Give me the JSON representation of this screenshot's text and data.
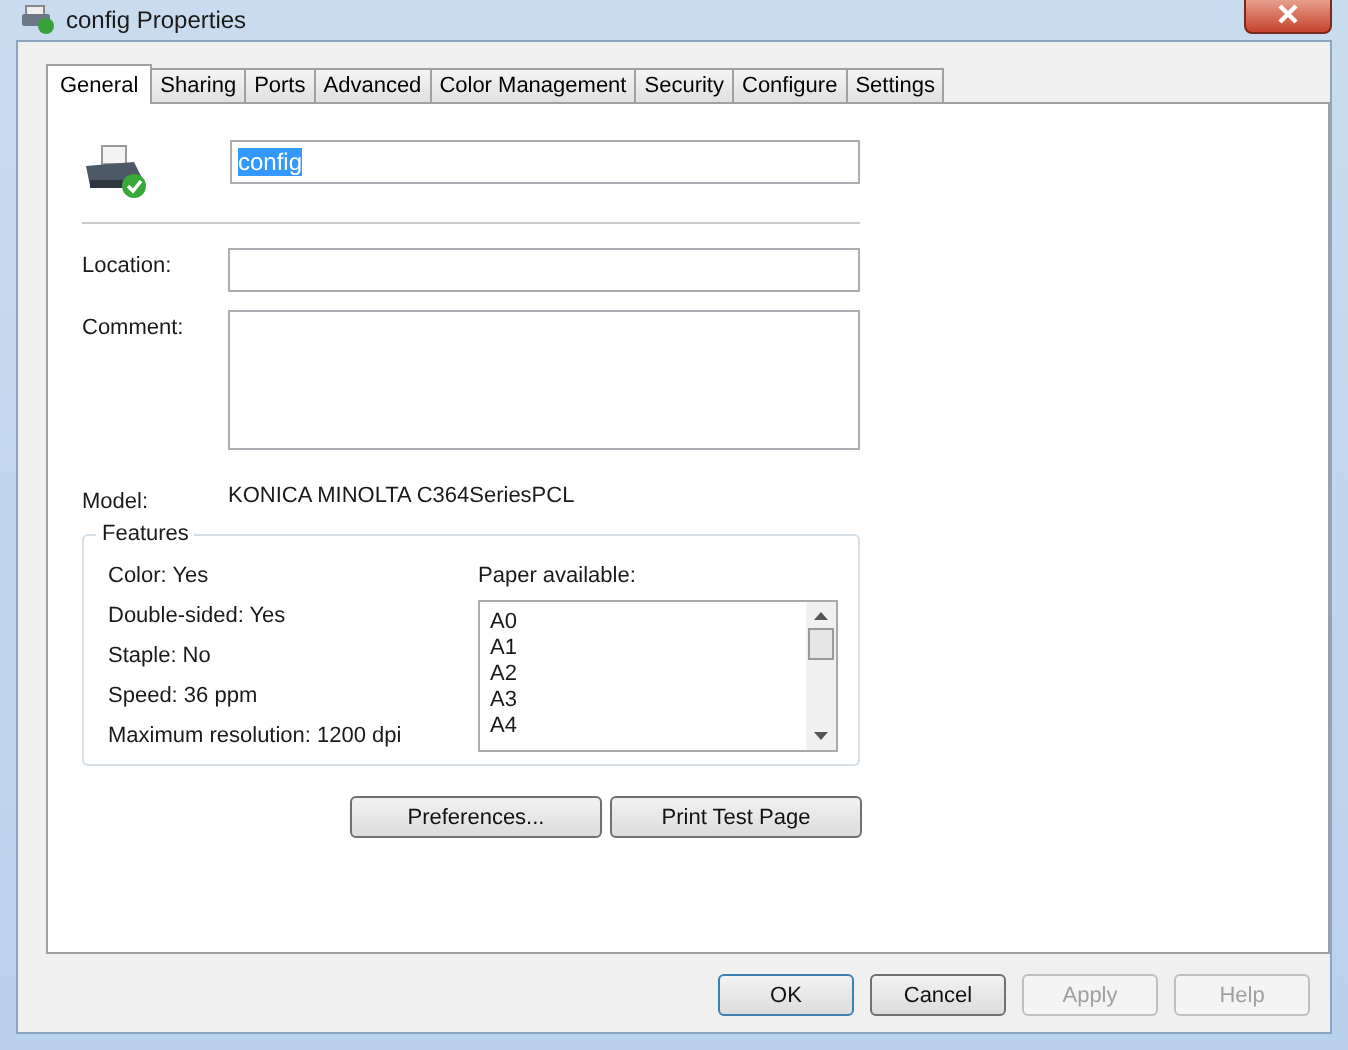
{
  "window": {
    "title": "config Properties"
  },
  "tabs": [
    {
      "label": "General",
      "selected": true
    },
    {
      "label": "Sharing",
      "selected": false
    },
    {
      "label": "Ports",
      "selected": false
    },
    {
      "label": "Advanced",
      "selected": false
    },
    {
      "label": "Color Management",
      "selected": false
    },
    {
      "label": "Security",
      "selected": false
    },
    {
      "label": "Configure",
      "selected": false
    },
    {
      "label": "Settings",
      "selected": false
    }
  ],
  "name_field": {
    "value": "config",
    "text_selected": true
  },
  "location": {
    "label": "Location:"
  },
  "comment": {
    "label": "Comment:"
  },
  "model": {
    "label": "Model:",
    "value": "KONICA MINOLTA C364SeriesPCL"
  },
  "features": {
    "title": "Features",
    "items": [
      "Color: Yes",
      "Double-sided: Yes",
      "Staple: No",
      "Speed: 36 ppm",
      "Maximum resolution: 1200 dpi"
    ],
    "paper_label": "Paper available:",
    "paper": [
      "A0",
      "A1",
      "A2",
      "A3",
      "A4"
    ]
  },
  "actions": [
    {
      "label": "Preferences..."
    },
    {
      "label": "Print Test Page"
    }
  ],
  "buttons": [
    {
      "label": "OK",
      "disabled": false,
      "default": true
    },
    {
      "label": "Cancel",
      "disabled": false,
      "default": false
    },
    {
      "label": "Apply",
      "disabled": true,
      "default": false
    },
    {
      "label": "Help",
      "disabled": true,
      "default": false
    }
  ]
}
